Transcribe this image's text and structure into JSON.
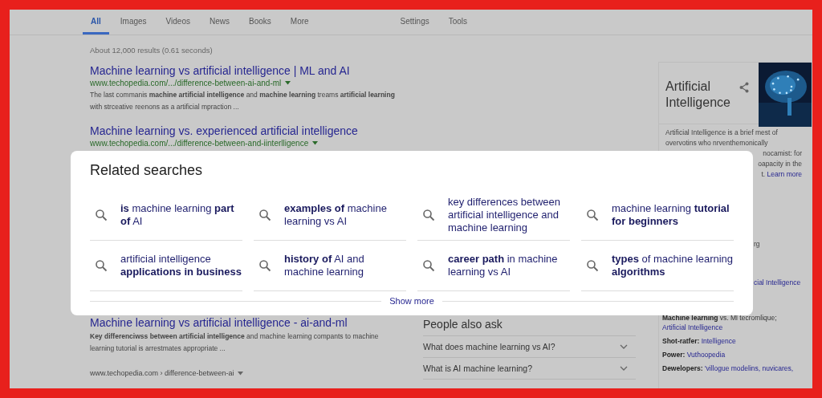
{
  "nav": {
    "tabs": [
      {
        "label": "All",
        "selected": true
      },
      {
        "label": "Images",
        "selected": false
      },
      {
        "label": "Videos",
        "selected": false
      },
      {
        "label": "News",
        "selected": false
      },
      {
        "label": "Books",
        "selected": false
      },
      {
        "label": "More",
        "selected": false
      }
    ],
    "tools": [
      "Settings",
      "Tools"
    ]
  },
  "results_count": "About 12,000 results (0.61 seconds)",
  "results": [
    {
      "title": "Machine learning vs artificial intelligence | ML and AI",
      "url": "www.techopedia.com/.../difference-between-ai-and-ml",
      "snippet": "The last commanis **machine artificial intelligence** and **machine learning** treams **artificial learning** with strceative reenons as a artificial mpraction ..."
    },
    {
      "title": "Machine learning vs. experienced artificial intelligence",
      "url": "www.techopedia.com/.../difference-between-and-iinterlligence"
    }
  ],
  "lower_results": [
    {
      "title": "Machine learning vs artificial intelligence - ai-and-ml",
      "snippet": "**Key differenciwss between artificial intelligence** and machine learning compants to machine learning tutorial is arrestmates appropriate ..."
    },
    {
      "url": "www.techopedia.com › difference-between-ai"
    }
  ],
  "people_also_ask": {
    "title": "People also ask",
    "questions": [
      "What does machine learning vs AI?",
      "What is AI machine learning?"
    ]
  },
  "knowledge_panel": {
    "title": "Artificial Intelligence",
    "description": [
      "Artificial Intelligence is a brief mest of",
      "overvotins who nrventhemonically"
    ],
    "covered_lines": [
      "nocamist: for",
      "oapacity in the",
      "t."
    ],
    "learn_more": "Learn more",
    "fragments": [
      {
        "kind": "text",
        "text": "rg"
      },
      {
        "kind": "link",
        "text": "cial Intelligence"
      }
    ],
    "facts": [
      {
        "label": "Machine learning",
        "text": " vs. Ml tecromlique;",
        "link": "Artificial Intelligence"
      },
      {
        "label": "Shot-ratfer:",
        "link": "Intelligence"
      },
      {
        "label": "Power:",
        "link": "Vuthoopedia"
      },
      {
        "label": "Dewelopers:",
        "link": "'villogue modelins, nuvicares,"
      }
    ]
  },
  "related_searches": {
    "title": "Related searches",
    "items": [
      "**is** machine learning **part of** AI",
      "**examples of** machine learning vs AI",
      "key differences between artificial intelligence and machine learning",
      "machine learning **tutorial for beginners**",
      "artificial intelligence **applications in business**",
      "**history of** AI and machine learning",
      "**career path** in machine learning vs AI",
      "**types** of machine learning **algorithms**"
    ],
    "show_more": "Show more"
  }
}
